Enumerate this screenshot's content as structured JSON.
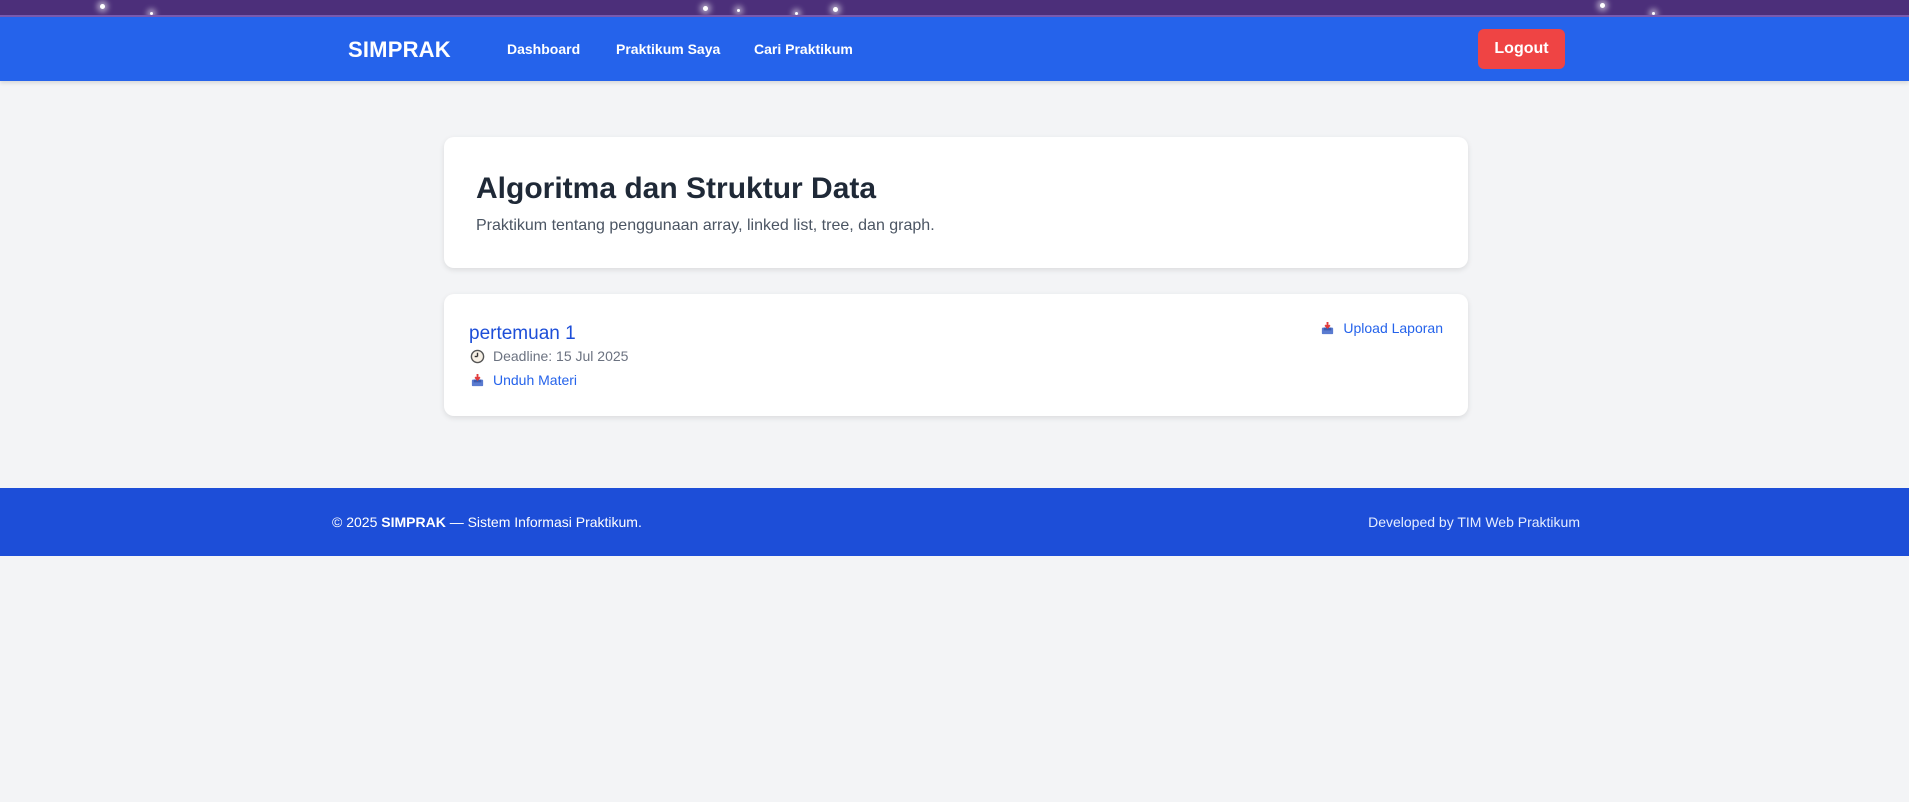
{
  "navbar": {
    "brand": "SIMPRAK",
    "links": [
      "Dashboard",
      "Praktikum Saya",
      "Cari Praktikum"
    ],
    "logout_label": "Logout"
  },
  "course": {
    "title": "Algoritma dan Struktur Data",
    "description": "Praktikum tentang penggunaan array, linked list, tree, dan graph."
  },
  "meeting": {
    "title": "pertemuan 1",
    "deadline": "Deadline: 15 Jul 2025",
    "download_label": "Unduh Materi",
    "upload_label": "Upload Laporan"
  },
  "footer": {
    "prefix": "© 2025 ",
    "brand": "SIMPRAK",
    "suffix": " — Sistem Informasi Praktikum.",
    "credit": "Developed by TIM Web Praktikum"
  },
  "colors": {
    "navbar": "#2563eb",
    "footer": "#1d4ed8",
    "logout": "#ef4444",
    "link": "#2563eb",
    "background": "#f3f4f6"
  },
  "icons": {
    "deadline": "clock-icon",
    "download": "inbox-tray-icon",
    "upload": "inbox-tray-icon"
  }
}
